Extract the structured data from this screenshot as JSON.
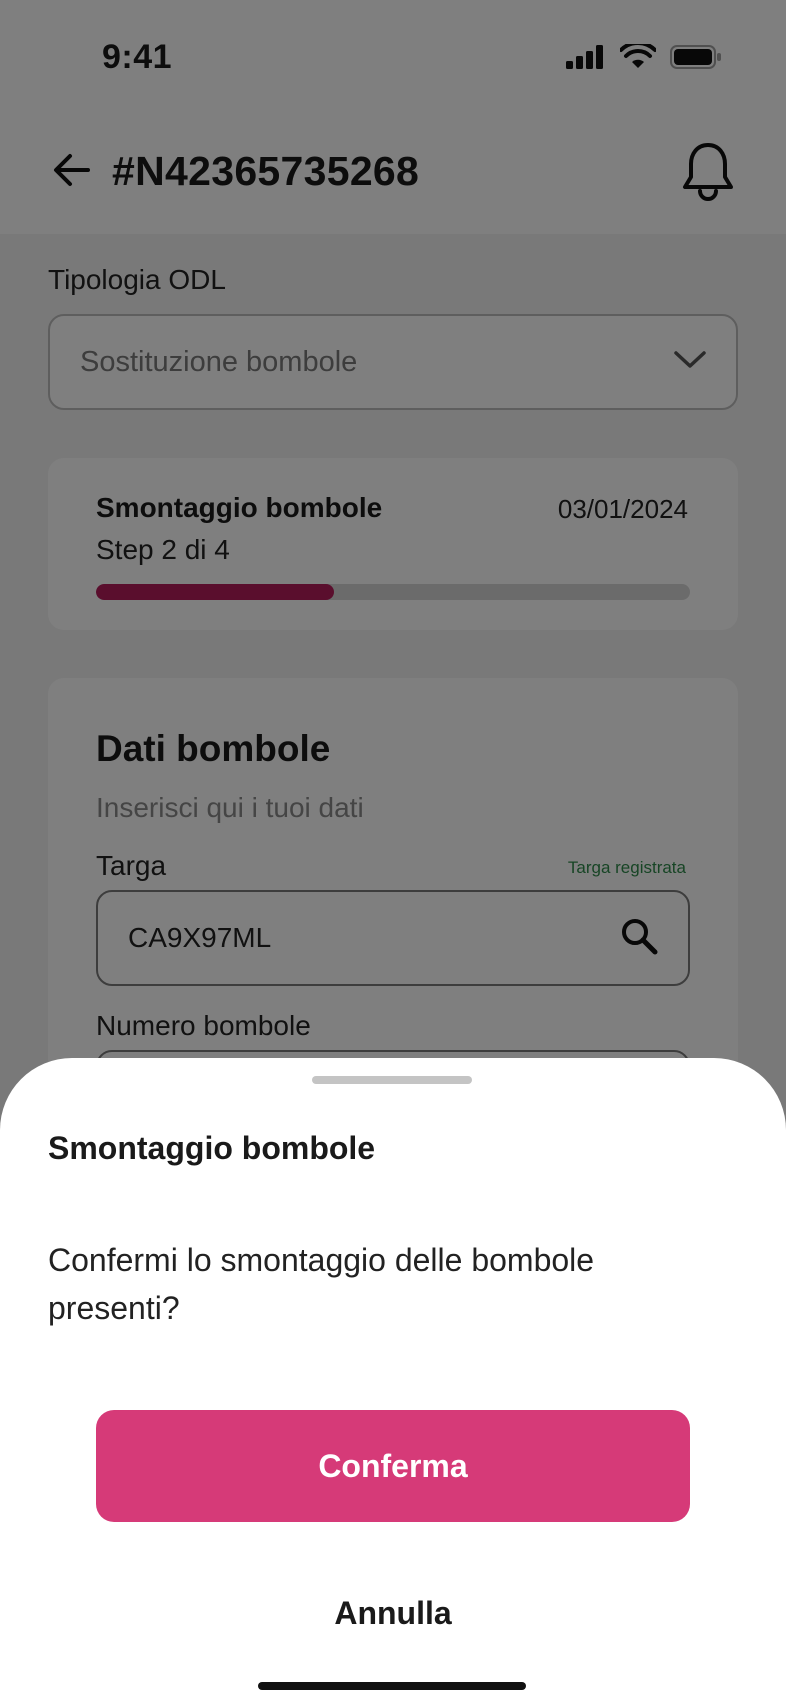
{
  "status_bar": {
    "time": "9:41",
    "icons": [
      "signal-icon",
      "wifi-icon",
      "battery-icon"
    ]
  },
  "header": {
    "back_icon": "arrow-left-icon",
    "title": "#N42365735268",
    "bell_icon": "bell-icon"
  },
  "odl": {
    "label": "Tipologia ODL",
    "value": "Sostituzione bombole",
    "chevron_icon": "chevron-down-icon"
  },
  "progress": {
    "title": "Smontaggio bombole",
    "date": "03/01/2024",
    "step": "Step 2 di 4",
    "fill_percent": 40,
    "fill_color": "#b51d5a"
  },
  "data_card": {
    "title": "Dati bombole",
    "subtitle": "Inserisci qui i tuoi dati",
    "targa_label": "Targa",
    "targa_status": "Targa registrata",
    "targa_value": "CA9X97ML",
    "search_icon": "search-icon",
    "numero_label": "Numero bombole"
  },
  "sheet": {
    "title": "Smontaggio bombole",
    "message": "Confermi lo smontaggio delle bombole presenti?",
    "confirm_label": "Conferma",
    "cancel_label": "Annulla",
    "confirm_color": "#d63a78"
  }
}
